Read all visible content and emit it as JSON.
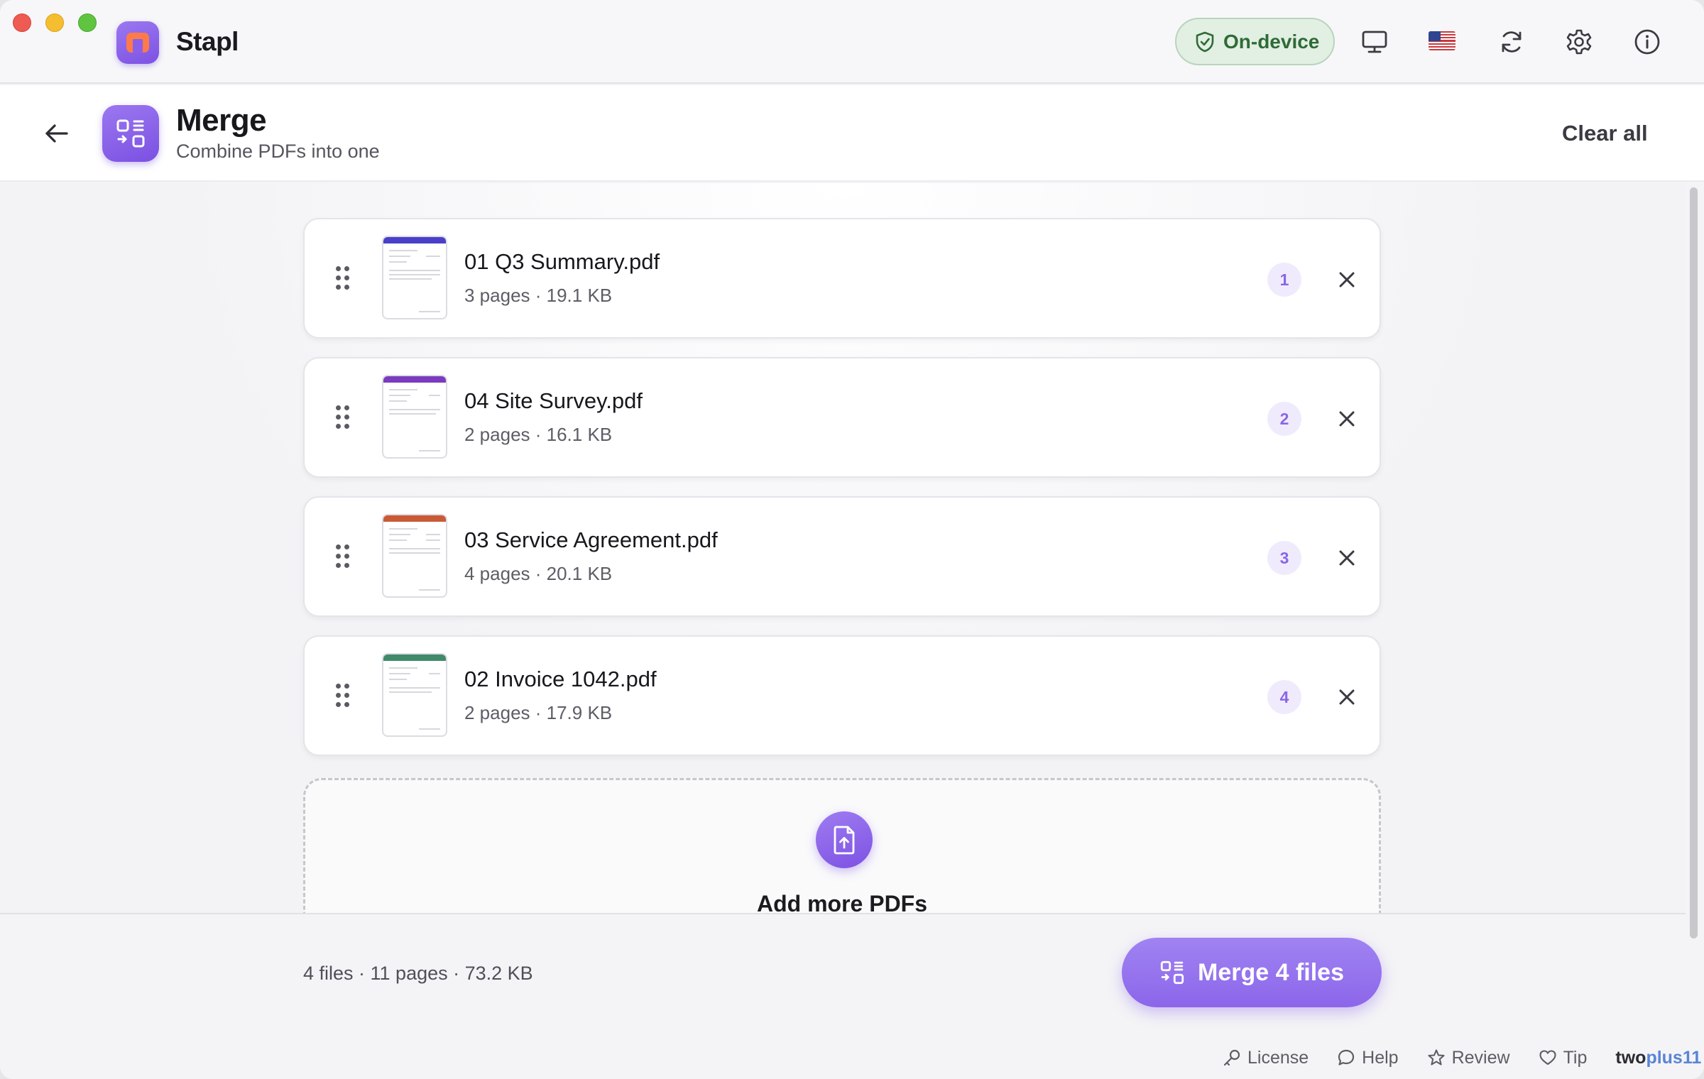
{
  "app": {
    "name": "Stapl",
    "status_badge": "On-device"
  },
  "header": {
    "title": "Merge",
    "subtitle": "Combine PDFs into one",
    "clear_all": "Clear all"
  },
  "files": [
    {
      "name": "01 Q3 Summary.pdf",
      "meta": "3 pages · 19.1 KB",
      "order": "1",
      "accent": "#4a3fc9"
    },
    {
      "name": "04 Site Survey.pdf",
      "meta": "2 pages · 16.1 KB",
      "order": "2",
      "accent": "#7a3bbf"
    },
    {
      "name": "03 Service Agreement.pdf",
      "meta": "4 pages · 20.1 KB",
      "order": "3",
      "accent": "#c95a35"
    },
    {
      "name": "02 Invoice 1042.pdf",
      "meta": "2 pages · 17.9 KB",
      "order": "4",
      "accent": "#3f8a6a"
    }
  ],
  "dropzone": {
    "label": "Add more PDFs"
  },
  "footer": {
    "summary": "4 files · 11 pages · 73.2 KB",
    "merge_button": "Merge 4 files",
    "links": {
      "license": "License",
      "help": "Help",
      "review": "Review",
      "tip": "Tip"
    },
    "brand_part1": "two",
    "brand_part2": "plus11"
  },
  "colors": {
    "accent": "#8c66ea",
    "on_device_green": "#2f6b37"
  },
  "icons": {
    "toolbar": [
      "display-icon",
      "us-flag-icon",
      "refresh-icon",
      "settings-gear-icon",
      "info-icon"
    ],
    "shield": "shield-check-icon",
    "upload": "file-upload-icon"
  }
}
